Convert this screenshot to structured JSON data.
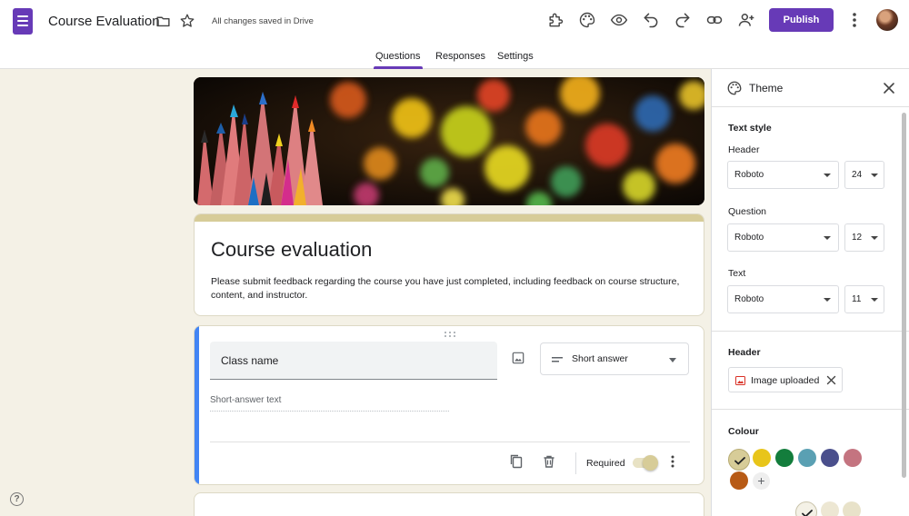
{
  "app": {
    "title": "Course Evaluation",
    "save_status": "All changes saved in Drive",
    "publish_label": "Publish"
  },
  "tabs": [
    {
      "label": "Questions",
      "active": true
    },
    {
      "label": "Responses",
      "active": false
    },
    {
      "label": "Settings",
      "active": false
    }
  ],
  "toolbar_icons": [
    "add-ons-icon",
    "palette-icon",
    "preview-icon",
    "undo-icon",
    "redo-icon",
    "link-icon",
    "add-collaborator-icon"
  ],
  "form": {
    "title": "Course evaluation",
    "description": "Please submit feedback regarding the course you have just completed, including feedback on course structure, content, and instructor."
  },
  "question": {
    "title": "Class name",
    "type": "Short answer",
    "answer_hint": "Short-answer text",
    "required_label": "Required",
    "required": true,
    "accent_color": "#4285f4"
  },
  "theme": {
    "title": "Theme",
    "text_style_label": "Text style",
    "header_label": "Header",
    "header_font": "Roboto",
    "header_size": "24",
    "question_label": "Question",
    "question_font": "Roboto",
    "question_size": "12",
    "text_label": "Text",
    "text_font": "Roboto",
    "text_size": "11",
    "header_section_label": "Header",
    "image_chip_label": "Image uploaded",
    "colour_label": "Colour",
    "colours": [
      "#d7cc98",
      "#e8c51a",
      "#137d3c",
      "#5aa0b3",
      "#4a4f8c",
      "#c47480",
      "#b75a15"
    ],
    "selected_colour": "#d7cc98",
    "background_swatches": [
      "#f4f1e6",
      "#ede7d3",
      "#e8e2c9"
    ]
  },
  "colors": {
    "brand": "#673ab7",
    "background": "#f4f1e6",
    "theme_strip": "#d7cc98"
  }
}
